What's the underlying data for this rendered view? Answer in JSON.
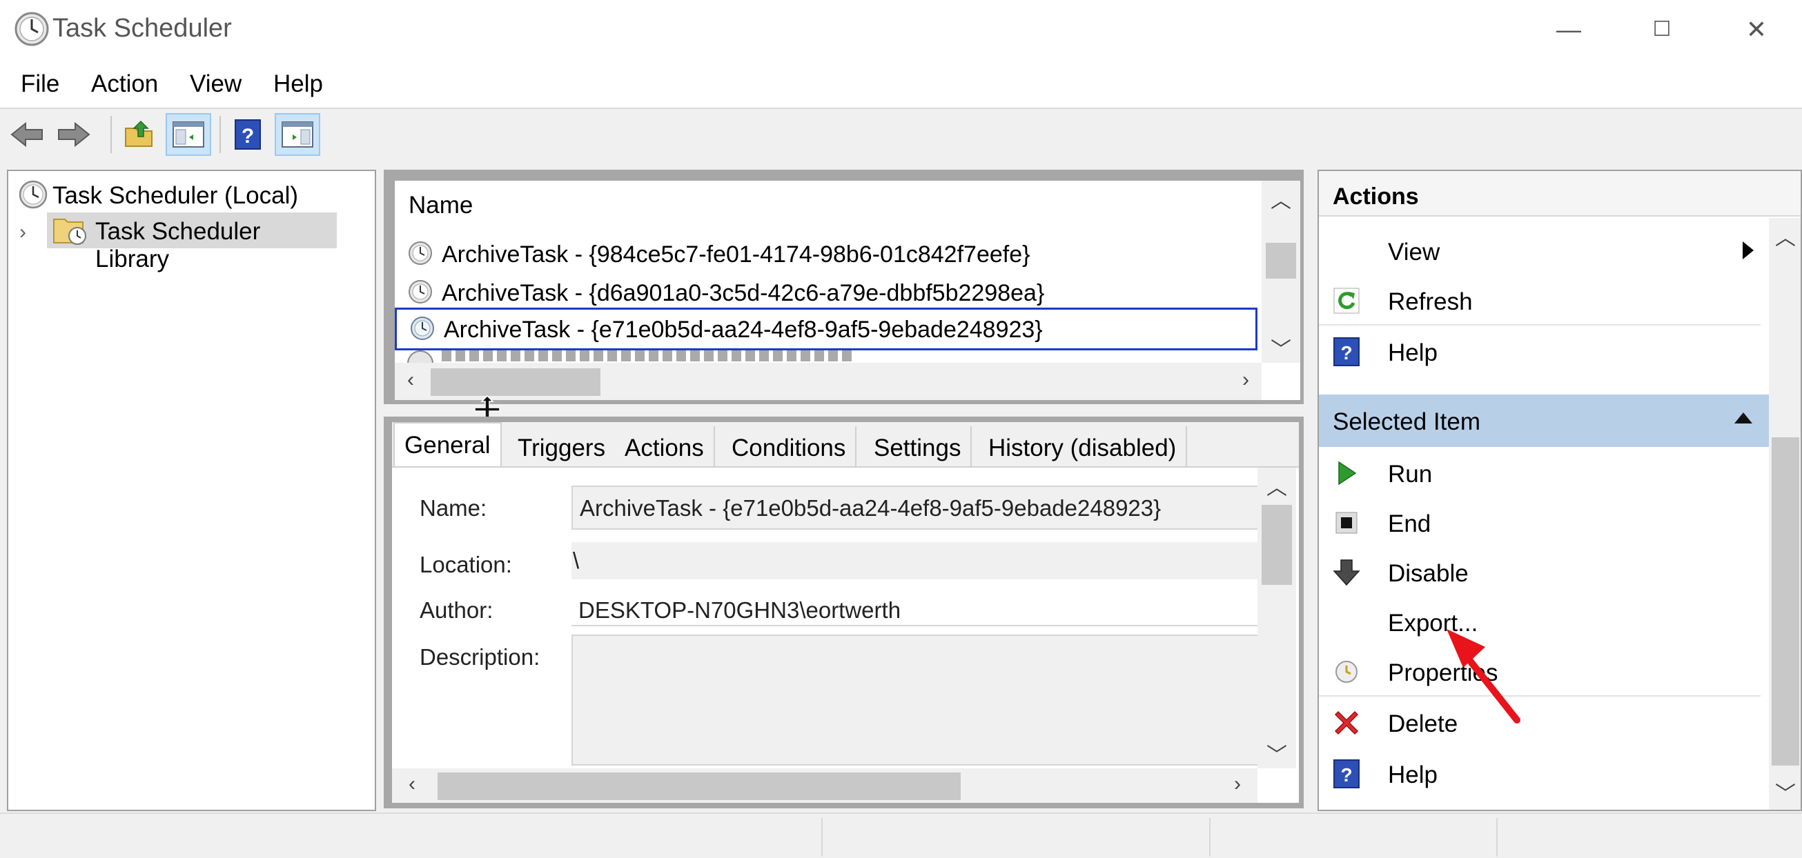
{
  "window": {
    "title": "Task Scheduler",
    "minimize_glyph": "—",
    "maximize_glyph": "☐",
    "close_glyph": "✕"
  },
  "menu": {
    "items": [
      {
        "label": "File"
      },
      {
        "label": "Action"
      },
      {
        "label": "View"
      },
      {
        "label": "Help"
      }
    ]
  },
  "toolbar": {
    "buttons": [
      {
        "icon": "back-arrow-icon"
      },
      {
        "icon": "forward-arrow-icon"
      },
      {
        "icon": "up-folder-icon"
      },
      {
        "icon": "show-hide-console-tree-icon"
      },
      {
        "icon": "help-icon"
      },
      {
        "icon": "show-hide-action-pane-icon"
      }
    ]
  },
  "tree": {
    "root_label": "Task Scheduler (Local)",
    "library_label": "Task Scheduler Library"
  },
  "task_list": {
    "column_header": "Name",
    "rows": [
      {
        "name": "ArchiveTask - {984ce5c7-fe01-4174-98b6-01c842f7eefe}",
        "selected": false
      },
      {
        "name": "ArchiveTask - {d6a901a0-3c5d-42c6-a79e-dbbf5b2298ea}",
        "selected": false
      },
      {
        "name": "ArchiveTask - {e71e0b5d-aa24-4ef8-9af5-9ebade248923}",
        "selected": true
      }
    ]
  },
  "details": {
    "tabs": [
      {
        "label": "General",
        "active": true
      },
      {
        "label": "Triggers"
      },
      {
        "label": "Actions"
      },
      {
        "label": "Conditions"
      },
      {
        "label": "Settings"
      },
      {
        "label": "History (disabled)"
      }
    ],
    "general": {
      "name_label": "Name:",
      "name_value": "ArchiveTask - {e71e0b5d-aa24-4ef8-9af5-9ebade248923}",
      "location_label": "Location:",
      "location_value": "\\",
      "author_label": "Author:",
      "author_value": "DESKTOP-N70GHN3\\eortwerth",
      "description_label": "Description:",
      "description_value": ""
    }
  },
  "actions_pane": {
    "title": "Actions",
    "top_items": [
      {
        "label": "View",
        "icon": "none",
        "has_submenu": true
      },
      {
        "label": "Refresh",
        "icon": "refresh-icon"
      },
      {
        "label": "Help",
        "icon": "help-icon"
      }
    ],
    "selected_item_title": "Selected Item",
    "selected_items": [
      {
        "label": "Run",
        "icon": "run-icon"
      },
      {
        "label": "End",
        "icon": "end-icon"
      },
      {
        "label": "Disable",
        "icon": "disable-icon"
      },
      {
        "label": "Export...",
        "icon": "none"
      },
      {
        "label": "Properties",
        "icon": "properties-icon"
      },
      {
        "label": "Delete",
        "icon": "delete-icon"
      },
      {
        "label": "Help",
        "icon": "help-icon"
      }
    ]
  },
  "colors": {
    "selection_border": "#1e39c9",
    "selected_header": "#b8cfe8",
    "annotation_arrow": "#e8131b"
  }
}
